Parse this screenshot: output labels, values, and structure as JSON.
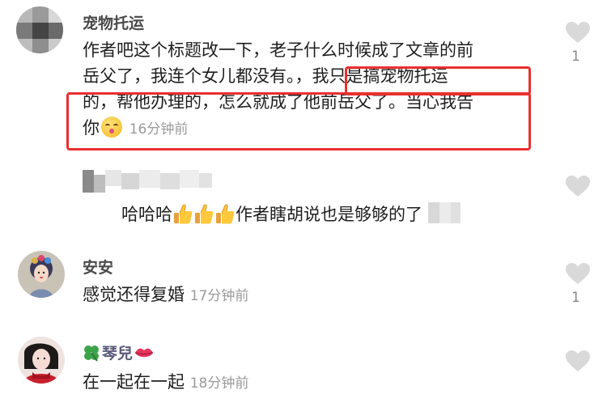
{
  "comments": [
    {
      "username": "宠物托运",
      "text_line1": "作者吧这个标题改一下，老子什么时候成了文章的前",
      "text_line2_a": "岳父了，我连个女儿都没有。，",
      "text_line2_b": "我只是搞宠物托运",
      "text_line3": "的，帮他办理的，怎么就成了他前岳父了。当心我告",
      "text_line4": "你",
      "time": "16分钟前",
      "likes": "1"
    },
    {
      "username": "",
      "text_a": "哈哈哈",
      "text_b": "作者瞎胡说也是够够的了",
      "likes": ""
    },
    {
      "username": "安安",
      "text": "感觉还得复婚",
      "time": "17分钟前",
      "likes": "1"
    },
    {
      "username": "琴兒",
      "text": "在一起在一起",
      "time": "18分钟前",
      "likes": ""
    }
  ],
  "colors": {
    "highlight": "#e8302f",
    "time": "#9a9a9a",
    "like_icon": "#d9d9d9"
  },
  "icons": [
    "heart-icon",
    "kiss-emoji-icon",
    "thumbs-up-emoji-icon",
    "clover-icon",
    "lips-icon"
  ]
}
